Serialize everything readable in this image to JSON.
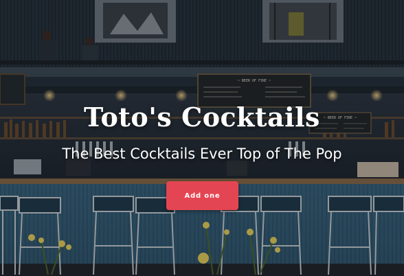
{
  "hero": {
    "title": "Toto's Cocktails",
    "subtitle": "The Best Cocktails Ever Top of The Pop",
    "cta_label": "Add one",
    "cta_color": "#e44552"
  },
  "background": {
    "menu_board_title": "~ BEER OF FIRE ~",
    "side_board_title": "~ BEER OF FIRE ~"
  }
}
